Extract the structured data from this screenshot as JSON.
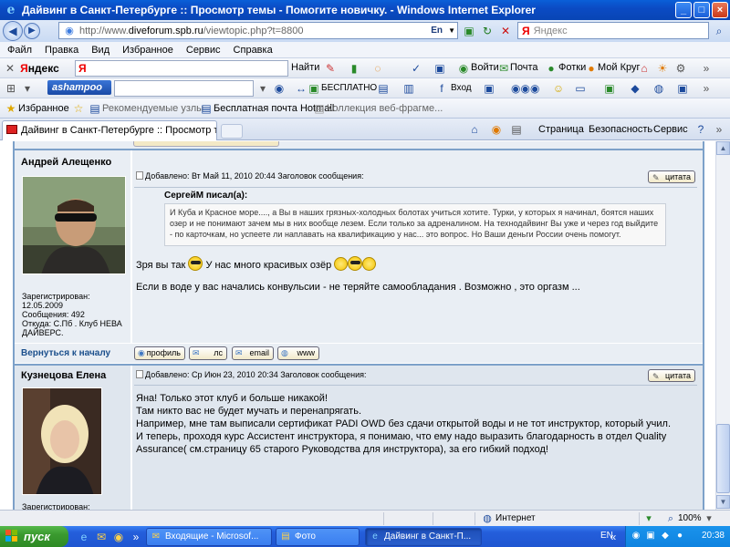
{
  "window": {
    "title": "Дайвинг в Санкт-Петербурге :: Просмотр темы - Помогите новичку. - Windows Internet Explorer"
  },
  "address": {
    "url_prefix": "http://www.",
    "url_host": "diveforum.spb.ru",
    "url_path": "/viewtopic.php?t=8800",
    "lang": "En",
    "search_placeholder": "Яндекс",
    "search_brand": "Я"
  },
  "menu": [
    "Файл",
    "Правка",
    "Вид",
    "Избранное",
    "Сервис",
    "Справка"
  ],
  "yandex_toolbar": {
    "brand_red": "Я",
    "brand_rest": "ндекс",
    "field_value": "Я",
    "find_label": "Найти",
    "login_label": "Войти",
    "mail_label": "Почта",
    "photos_label": "Фотки",
    "circle_label": "Мой Круг"
  },
  "ashampoo_toolbar": {
    "logo": "ashampoo",
    "free_label": "БЕСПЛАТНО",
    "login_label": "Вход"
  },
  "favorites_bar": {
    "favorites_label": "Избранное",
    "recommended_label": "Рекомендуемые узлы",
    "hotmail_label": "Бесплатная почта Hotmail",
    "webslices_label": "Коллекция веб-фрагме..."
  },
  "tabs": {
    "active_label": "Дайвинг в Санкт-Петербурге :: Просмотр темы - ...",
    "page_label": "Страница",
    "safety_label": "Безопасность",
    "tools_label": "Сервис"
  },
  "posts": [
    {
      "author": "Андрей Алещенко",
      "header": "Добавлено: Вт Май 11, 2010 20:44    Заголовок сообщения:",
      "quote_button": "цитата",
      "quote_author": "СергейМ писал(а):",
      "quote_text": "И Куба и Красное море...., а Вы в наших грязных-холодных болотах учиться хотите. Турки, у которых я начинал, боятся наших озер и не понимают зачем мы в них вообще лезем. Если только за адреналином. На технодайвинг Вы уже и через год выйдите - по карточкам, но успеете ли наплавать на квалификацию у нас... это вопрос. Но Ваши деньги России очень помогут.",
      "reply_part1": "Зря вы так",
      "reply_part2": "У нас много красивых озёр",
      "reply_line2": "Если в воде у вас начались конвульсии - не теряйте самообладания . Возможно , это оргазм ...",
      "info": {
        "registered_label": "Зарегистрирован:",
        "registered_date": "12.05.2009",
        "messages": "Сообщения: 492",
        "from": "Откуда: С.Пб . Клуб НЕВА ДАЙВЕРС."
      }
    },
    {
      "author": "Кузнецова Елена",
      "header": "Добавлено: Ср Июн 23, 2010 20:34    Заголовок сообщения:",
      "quote_button": "цитата",
      "lines": [
        "Яна! Только этот клуб и больше никакой!",
        "Там никто вас не будет мучать и перенапрягать.",
        "Например, мне там выписали сертификат PADI OWD без сдачи открытой воды и не тот инструктор, который учил.",
        "И теперь, проходя курс Ассистент инструктора, я понимаю, что ему надо выразить благодарность в отдел Quality",
        "Assurance( см.страницу 65 старого Руководства для инструктора), за его гибкий подход!"
      ],
      "info": {
        "registered_label": "Зарегистрирован:"
      }
    }
  ],
  "post_footer": {
    "back_label": "Вернуться к началу",
    "buttons": [
      "профиль",
      "лс",
      "email",
      "www"
    ]
  },
  "statusbar": {
    "zone": "Интернет",
    "zoom": "100%"
  },
  "taskbar": {
    "start_label": "пуск",
    "tasks": [
      "Входящие - Microsof...",
      "Фото",
      "Дайвинг в Санкт-П..."
    ],
    "lang": "EN",
    "clock": "20:38"
  },
  "colors": {
    "title_blue": "#0b4bc4",
    "forum_row": "#e9eef4",
    "link_blue": "#1b4f8c",
    "taskbar_blue": "#245edb",
    "start_green": "#3a9a2f"
  }
}
